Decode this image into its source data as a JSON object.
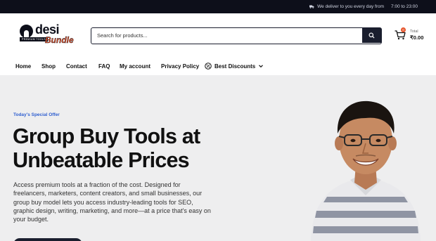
{
  "topbar": {
    "delivery_text": "We deliver to you every day from",
    "hours": "7:00 to 23:00"
  },
  "logo": {
    "word1": "desi",
    "tagline": "PREMIUM TOOLS",
    "word2": "Bundle"
  },
  "search": {
    "placeholder": "Search for products..."
  },
  "cart": {
    "count": "0",
    "label": "Total",
    "amount": "₹0.00"
  },
  "nav": {
    "items": [
      "Home",
      "Shop",
      "Contact",
      "FAQ",
      "My account",
      "Privacy Policy"
    ],
    "discounts_label": "Best Discounts"
  },
  "hero": {
    "eyebrow": "Today's Special Offer",
    "title": "Group Buy Tools at Unbeatable Prices",
    "description": "Access premium tools at a fraction of the cost. Designed for freelancers, marketers, content creators, and small businesses, our group buy model lets you access industry-leading tools for SEO, graphic design, writing, marketing, and more—at a price that's easy on your budget."
  },
  "colors": {
    "dark": "#0d0f1a",
    "accent": "#e5542b",
    "eyebrow": "#2f5fd0",
    "hero_bg": "#eeeeef"
  },
  "icons": {
    "truck": "truck-icon",
    "search": "search-icon",
    "cart": "cart-icon",
    "discount": "percent-badge-icon",
    "chevron": "chevron-down-icon"
  }
}
